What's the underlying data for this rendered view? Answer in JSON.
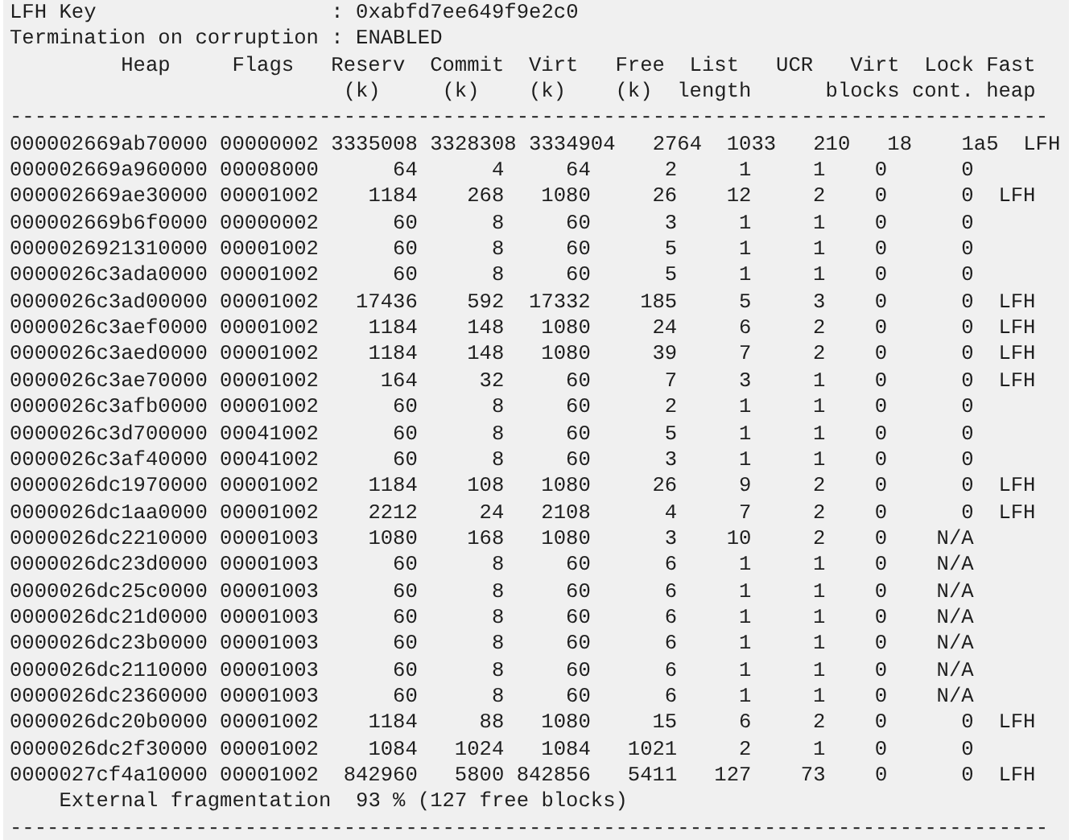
{
  "info": [
    {
      "label": "LFH Key",
      "separator": ":",
      "value": "0xabfd7ee649f9e2c0"
    },
    {
      "label": "Termination on corruption",
      "separator": ":",
      "value": "ENABLED"
    }
  ],
  "table": {
    "columns": [
      {
        "line1": "Heap"
      },
      {
        "line1": "Flags"
      },
      {
        "line1": "Reserv",
        "line2": "(k)"
      },
      {
        "line1": "Commit",
        "line2": "(k)"
      },
      {
        "line1": "Virt",
        "line2": "(k)"
      },
      {
        "line1": "Free",
        "line2": "(k)"
      },
      {
        "line1": "List",
        "line2": "length"
      },
      {
        "line1": "UCR"
      },
      {
        "line1": "Virt",
        "line2": "blocks"
      },
      {
        "line1": "Lock",
        "line2": "cont."
      },
      {
        "line1": "Fast",
        "line2": "heap"
      }
    ],
    "rule_top": "------------------------------------------------------------------------------------",
    "rows": [
      [
        "000002669ab70000",
        "00000002",
        "3335008",
        "3328308",
        "3334904",
        "2764",
        "1033",
        "210",
        "18",
        "1a5",
        "LFH"
      ],
      [
        "000002669a960000",
        "00008000",
        "64",
        "4",
        "64",
        "2",
        "1",
        "1",
        "0",
        "0"
      ],
      [
        "000002669ae30000",
        "00001002",
        "1184",
        "268",
        "1080",
        "26",
        "12",
        "2",
        "0",
        "0",
        "LFH"
      ],
      [
        "000002669b6f0000",
        "00000002",
        "60",
        "8",
        "60",
        "3",
        "1",
        "1",
        "0",
        "0"
      ],
      [
        "0000026921310000",
        "00001002",
        "60",
        "8",
        "60",
        "5",
        "1",
        "1",
        "0",
        "0"
      ],
      [
        "0000026c3ada0000",
        "00001002",
        "60",
        "8",
        "60",
        "5",
        "1",
        "1",
        "0",
        "0"
      ],
      [
        "0000026c3ad00000",
        "00001002",
        "17436",
        "592",
        "17332",
        "185",
        "5",
        "3",
        "0",
        "0",
        "LFH"
      ],
      [
        "0000026c3aef0000",
        "00001002",
        "1184",
        "148",
        "1080",
        "24",
        "6",
        "2",
        "0",
        "0",
        "LFH"
      ],
      [
        "0000026c3aed0000",
        "00001002",
        "1184",
        "148",
        "1080",
        "39",
        "7",
        "2",
        "0",
        "0",
        "LFH"
      ],
      [
        "0000026c3ae70000",
        "00001002",
        "164",
        "32",
        "60",
        "7",
        "3",
        "1",
        "0",
        "0",
        "LFH"
      ],
      [
        "0000026c3afb0000",
        "00001002",
        "60",
        "8",
        "60",
        "2",
        "1",
        "1",
        "0",
        "0"
      ],
      [
        "0000026c3d700000",
        "00041002",
        "60",
        "8",
        "60",
        "5",
        "1",
        "1",
        "0",
        "0"
      ],
      [
        "0000026c3af40000",
        "00041002",
        "60",
        "8",
        "60",
        "3",
        "1",
        "1",
        "0",
        "0"
      ],
      [
        "0000026dc1970000",
        "00001002",
        "1184",
        "108",
        "1080",
        "26",
        "9",
        "2",
        "0",
        "0",
        "LFH"
      ],
      [
        "0000026dc1aa0000",
        "00001002",
        "2212",
        "24",
        "2108",
        "4",
        "7",
        "2",
        "0",
        "0",
        "LFH"
      ],
      [
        "0000026dc2210000",
        "00001003",
        "1080",
        "168",
        "1080",
        "3",
        "10",
        "2",
        "0",
        "N/A"
      ],
      [
        "0000026dc23d0000",
        "00001003",
        "60",
        "8",
        "60",
        "6",
        "1",
        "1",
        "0",
        "N/A"
      ],
      [
        "0000026dc25c0000",
        "00001003",
        "60",
        "8",
        "60",
        "6",
        "1",
        "1",
        "0",
        "N/A"
      ],
      [
        "0000026dc21d0000",
        "00001003",
        "60",
        "8",
        "60",
        "6",
        "1",
        "1",
        "0",
        "N/A"
      ],
      [
        "0000026dc23b0000",
        "00001003",
        "60",
        "8",
        "60",
        "6",
        "1",
        "1",
        "0",
        "N/A"
      ],
      [
        "0000026dc2110000",
        "00001003",
        "60",
        "8",
        "60",
        "6",
        "1",
        "1",
        "0",
        "N/A"
      ],
      [
        "0000026dc2360000",
        "00001003",
        "60",
        "8",
        "60",
        "6",
        "1",
        "1",
        "0",
        "N/A"
      ],
      [
        "0000026dc20b0000",
        "00001002",
        "1184",
        "88",
        "1080",
        "15",
        "6",
        "2",
        "0",
        "0",
        "LFH"
      ],
      [
        "0000026dc2f30000",
        "00001002",
        "1084",
        "1024",
        "1084",
        "1021",
        "2",
        "1",
        "0",
        "0"
      ],
      [
        "0000027cf4a10000",
        "00001002",
        "842960",
        "5800",
        "842856",
        "5411",
        "127",
        "73",
        "0",
        "0",
        "LFH"
      ]
    ],
    "summary": "External fragmentation  93 % (127 free blocks)",
    "rule_bottom": "------------------------------------------------------------------------------------"
  }
}
